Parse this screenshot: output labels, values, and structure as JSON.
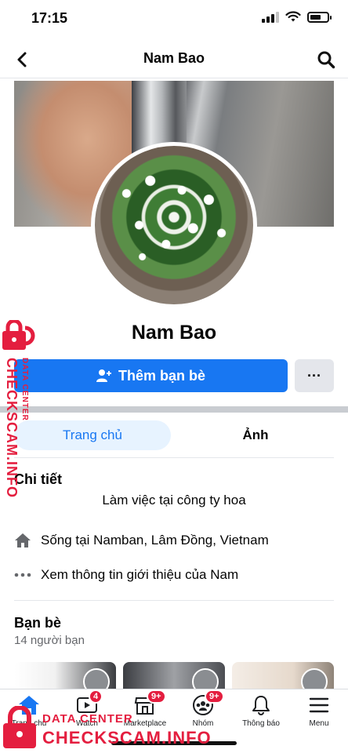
{
  "status_bar": {
    "time": "17:15",
    "battery_level": 0.65
  },
  "nav": {
    "title": "Nam Bao",
    "back_icon": "chevron-left-icon",
    "search_icon": "search-icon"
  },
  "profile": {
    "name": "Nam Bao",
    "add_friend_label": "Thêm bạn bè",
    "add_friend_icon": "add-friend-icon",
    "more_label": "···"
  },
  "tabs": [
    {
      "label": "Trang chủ",
      "active": true
    },
    {
      "label": "Ảnh",
      "active": false
    }
  ],
  "details": {
    "title": "Chi tiết",
    "work": "Làm việc tại công ty hoa",
    "lives": "Sống tại Namban, Lâm Đồng, Vietnam",
    "about": "Xem thông tin giới thiệu của Nam"
  },
  "friends": {
    "title": "Bạn bè",
    "count": "14 người bạn"
  },
  "tab_bar": {
    "items": [
      {
        "label": "Trang chủ",
        "icon": "home-icon",
        "badge": ""
      },
      {
        "label": "Watch",
        "icon": "video-icon",
        "badge": "4"
      },
      {
        "label": "Marketplace",
        "icon": "shop-icon",
        "badge": "9+"
      },
      {
        "label": "Nhóm",
        "icon": "groups-icon",
        "badge": "9+"
      },
      {
        "label": "Thông báo",
        "icon": "bell-icon",
        "badge": ""
      },
      {
        "label": "Menu",
        "icon": "menu-icon",
        "badge": ""
      }
    ]
  },
  "watermark": {
    "line1": "DATA CENTER",
    "line2": "CHECKSCAM.INFO"
  },
  "colors": {
    "primary": "#1877f2",
    "badge": "#e41e3f",
    "watermark": "#e41e3f"
  }
}
